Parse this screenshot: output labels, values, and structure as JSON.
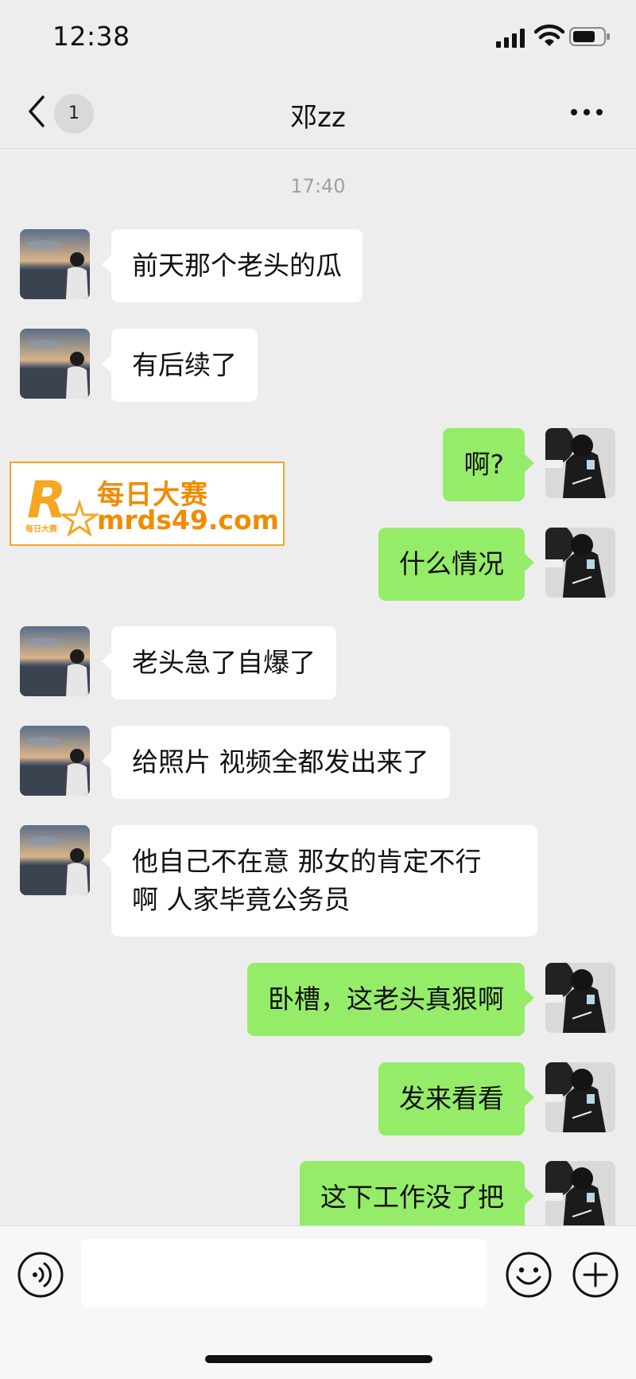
{
  "status_bar": {
    "time": "12:38"
  },
  "nav": {
    "back_badge": "1",
    "title": "邓zz"
  },
  "timestamp": "17:40",
  "messages": [
    {
      "side": "left",
      "text": "前天那个老头的瓜"
    },
    {
      "side": "left",
      "text": "有后续了"
    },
    {
      "side": "right",
      "text": "啊?"
    },
    {
      "side": "right",
      "text": "什么情况"
    },
    {
      "side": "left",
      "text": "老头急了自爆了"
    },
    {
      "side": "left",
      "text": "给照片 视频全都发出来了"
    },
    {
      "side": "left",
      "text": "他自己不在意 那女的肯定不行\n啊 人家毕竟公务员"
    },
    {
      "side": "right",
      "text": "卧槽，这老头真狠啊"
    },
    {
      "side": "right",
      "text": "发来看看"
    },
    {
      "side": "right",
      "text": "这下工作没了把"
    }
  ],
  "watermark": {
    "logo_letter": "R",
    "logo_small": "每日大赛",
    "name": "每日大赛",
    "url": "mrds49.com"
  },
  "colors": {
    "background": "#ededed",
    "self_bubble": "#95ec69",
    "other_bubble": "#ffffff",
    "watermark": "#f08c00"
  },
  "icons": {
    "back": "chevron-left-icon",
    "more": "more-dots-icon",
    "voice": "voice-icon",
    "emoji": "emoji-icon",
    "plus": "plus-icon",
    "signal": "signal-icon",
    "wifi": "wifi-icon",
    "battery": "battery-icon"
  }
}
